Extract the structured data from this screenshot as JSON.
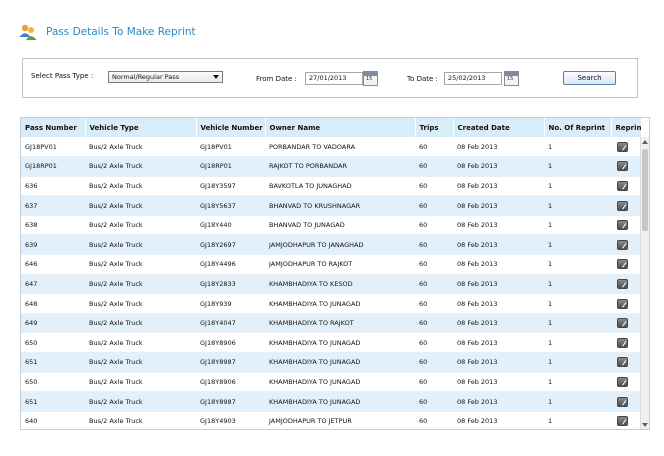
{
  "header": {
    "title": "Pass Details To Make Reprint"
  },
  "filters": {
    "pass_type_label": "Select Pass Type :",
    "pass_type_value": "Normal/Regular Pass",
    "from_label": "From Date :",
    "from_value": "27/01/2013",
    "to_label": "To Date :",
    "to_value": "25/02/2013",
    "calendar_number": "15",
    "search_label": "Search"
  },
  "table": {
    "headers": [
      "Pass Number",
      "Vehicle Type",
      "Vehicle Number",
      "Owner Name",
      "Trips",
      "Created Date",
      "No. Of Reprint",
      "Reprint"
    ],
    "rows": [
      [
        "GJ18PV01",
        "Bus/2 Axle Truck",
        "GJ18PV01",
        "PORBANDAR TO VADOARA",
        "60",
        "08 Feb 2013",
        "1"
      ],
      [
        "GJ18RP01",
        "Bus/2 Axle Truck",
        "GJ18RP01",
        "RAJKOT TO PORBANDAR",
        "60",
        "08 Feb 2013",
        "1"
      ],
      [
        "636",
        "Bus/2 Axle Truck",
        "GJ18Y3597",
        "BAVKOTLA TO JUNAGHAD",
        "60",
        "08 Feb 2013",
        "1"
      ],
      [
        "637",
        "Bus/2 Axle Truck",
        "GJ18Y5637",
        "BHANVAD TO KRUSHNAGAR",
        "60",
        "08 Feb 2013",
        "1"
      ],
      [
        "638",
        "Bus/2 Axle Truck",
        "GJ18Y440",
        "BHANVAD TO JUNAGAD",
        "60",
        "08 Feb 2013",
        "1"
      ],
      [
        "639",
        "Bus/2 Axle Truck",
        "GJ18Y2697",
        "JAMJODHAPUR TO JANAGHAD",
        "60",
        "08 Feb 2013",
        "1"
      ],
      [
        "646",
        "Bus/2 Axle Truck",
        "GJ18Y4496",
        "JAMJODHAPUR TO RAJKOT",
        "60",
        "08 Feb 2013",
        "1"
      ],
      [
        "647",
        "Bus/2 Axle Truck",
        "GJ18Y2833",
        "KHAMBHADIYA TO KESOD",
        "60",
        "08 Feb 2013",
        "1"
      ],
      [
        "648",
        "Bus/2 Axle Truck",
        "GJ18Y939",
        "KHAMBHADIYA TO JUNAGAD",
        "60",
        "08 Feb 2013",
        "1"
      ],
      [
        "649",
        "Bus/2 Axle Truck",
        "GJ18Y4047",
        "KHAMBHADIYA TO RAJKOT",
        "60",
        "08 Feb 2013",
        "1"
      ],
      [
        "650",
        "Bus/2 Axle Truck",
        "GJ18Y8906",
        "KHAMBHADIYA TO JUNAGAD",
        "60",
        "08 Feb 2013",
        "1"
      ],
      [
        "651",
        "Bus/2 Axle Truck",
        "GJ18Y8987",
        "KHAMBHADIYA TO JUNAGAD",
        "60",
        "08 Feb 2013",
        "1"
      ],
      [
        "650",
        "Bus/2 Axle Truck",
        "GJ18Y8906",
        "KHAMBHADIYA TO JUNAGAD",
        "60",
        "08 Feb 2013",
        "1"
      ],
      [
        "651",
        "Bus/2 Axle Truck",
        "GJ18Y8987",
        "KHAMBHADIYA TO JUNAGAD",
        "60",
        "08 Feb 2013",
        "1"
      ],
      [
        "640",
        "Bus/2 Axle Truck",
        "GJ18Y4903",
        "JAMJODHAPUR TO JETPUR",
        "60",
        "08 Feb 2013",
        "1"
      ]
    ]
  },
  "colors": {
    "title": "#2a8ac6",
    "header_bg": "#d9ecf9",
    "row_alt": "#e1f0fb"
  }
}
